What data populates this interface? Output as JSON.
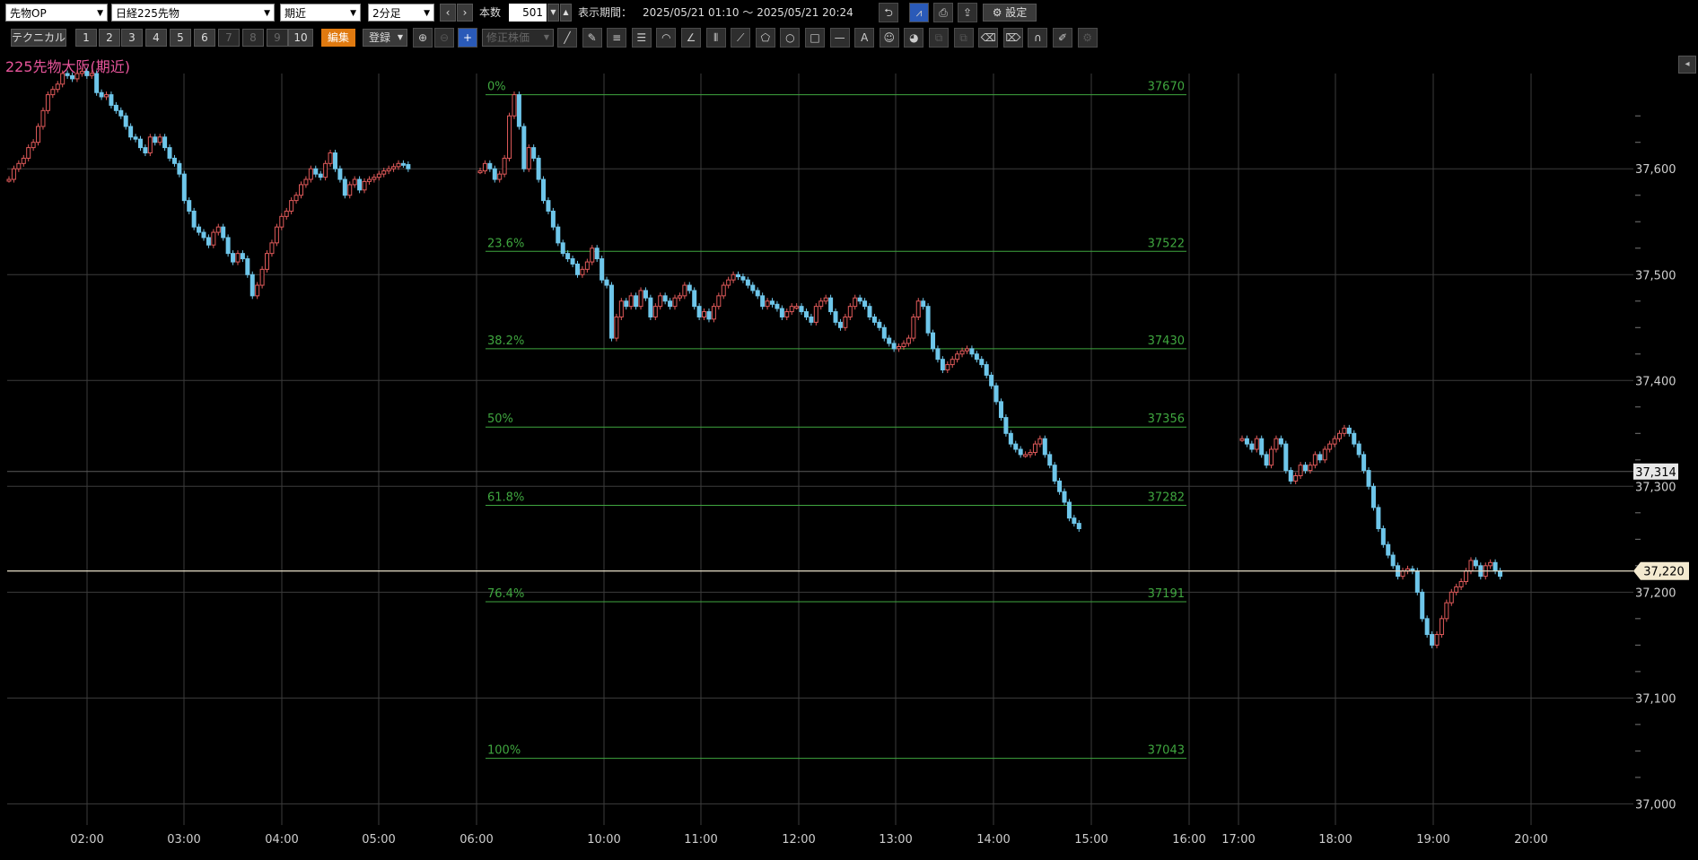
{
  "toolbar": {
    "product_select": "先物OP",
    "symbol_select": "日経225先物",
    "contract_select": "期近",
    "interval_select": "2分足",
    "bars_label": "本数",
    "bars_value": "501",
    "period_label": "表示期間：",
    "period_value": "2025/05/21 01:10 ～ 2025/05/21 20:24",
    "settings_label": "設定",
    "technical_label": "テクニカル",
    "preset_buttons": [
      "1",
      "2",
      "3",
      "4",
      "5",
      "6",
      "7",
      "8",
      "9",
      "10"
    ],
    "edit_label": "編集",
    "register_label": "登録",
    "adjusted_label": "修正株価"
  },
  "chart_title": "225先物大阪(期近)",
  "colors": {
    "up": "#e05a5a",
    "down": "#6ec6ea",
    "fib": "#3fa63f",
    "grid": "#3c3c3c",
    "title": "#e8559b"
  },
  "chart_data": {
    "type": "candlestick",
    "x_ticks": [
      "02:00",
      "03:00",
      "04:00",
      "05:00",
      "06:00",
      "10:00",
      "11:00",
      "12:00",
      "13:00",
      "14:00",
      "15:00",
      "16:00",
      "17:00",
      "18:00",
      "19:00",
      "20:00"
    ],
    "y_ticks": [
      "37,600",
      "37,500",
      "37,400",
      "37,300",
      "37,200",
      "37,100",
      "37,000"
    ],
    "ylim": [
      36980,
      37690
    ],
    "current_price_label": "37,220",
    "current_price": 37220,
    "marker_price_label": "37,314",
    "marker_price": 37314,
    "fibonacci": [
      {
        "label": "0%",
        "price": 37670
      },
      {
        "label": "23.6%",
        "price": 37522
      },
      {
        "label": "38.2%",
        "price": 37430
      },
      {
        "label": "50%",
        "price": 37356
      },
      {
        "label": "61.8%",
        "price": 37282
      },
      {
        "label": "76.4%",
        "price": 37191
      },
      {
        "label": "100%",
        "price": 37043
      }
    ],
    "fib_value_labels": [
      "37670",
      "37522",
      "37430",
      "37356",
      "37282",
      "37191",
      "37043"
    ],
    "segments": [
      {
        "time": "01:10",
        "closes": [
          37590,
          37600,
          37605,
          37610,
          37620,
          37625,
          37640,
          37655,
          37670,
          37675,
          37680,
          37690,
          37688,
          37685,
          37690,
          37692,
          37688,
          37690,
          37672,
          37668,
          37670,
          37660,
          37655,
          37650,
          37640,
          37630,
          37628,
          37620,
          37615,
          37630,
          37625,
          37630,
          37620,
          37610,
          37605,
          37595,
          37570,
          37560,
          37545,
          37540,
          37535,
          37528,
          37540,
          37545,
          37535,
          37520,
          37512,
          37520,
          37515,
          37500,
          37480,
          37490,
          37505,
          37520,
          37530,
          37545,
          37555,
          37560,
          37570,
          37575,
          37585,
          37590,
          37600,
          37595,
          37592,
          37605,
          37615,
          37600,
          37590,
          37575,
          37585,
          37590,
          37580,
          37588,
          37590,
          37592,
          37595,
          37598,
          37600,
          37602,
          37605,
          37604,
          37600
        ]
      },
      {
        "time": "06:00",
        "closes": [
          37598,
          37605,
          37600,
          37590,
          37595,
          37610,
          37650,
          37670,
          37640,
          37600,
          37620,
          37610,
          37590,
          37570,
          37560,
          37545,
          37530,
          37520,
          37515,
          37510,
          37500,
          37505,
          37512,
          37525,
          37515,
          37495,
          37490,
          37440,
          37460,
          37475,
          37470,
          37480,
          37470,
          37485,
          37478,
          37460,
          37470,
          37480,
          37475,
          37470,
          37478,
          37480,
          37490,
          37485,
          37470,
          37460,
          37465,
          37458,
          37470,
          37480,
          37490,
          37495,
          37500,
          37498,
          37495,
          37490,
          37485,
          37480,
          37470,
          37475,
          37472,
          37468,
          37460,
          37465,
          37470,
          37470,
          37465,
          37460,
          37455,
          37470,
          37475,
          37478,
          37465,
          37455,
          37450,
          37460,
          37470,
          37478,
          37475,
          37470,
          37460,
          37455,
          37450,
          37440,
          37435,
          37430,
          37432,
          37435,
          37440,
          37460,
          37475,
          37470,
          37445,
          37430,
          37420,
          37410,
          37415,
          37420,
          37425,
          37428,
          37430,
          37425,
          37420,
          37415,
          37405,
          37395,
          37380,
          37365,
          37350,
          37340,
          37335,
          37330,
          37330,
          37332,
          37340,
          37345,
          37330,
          37320,
          37305,
          37295,
          37285,
          37270,
          37265,
          37260
        ]
      },
      {
        "time": "17:00",
        "closes": [
          37345,
          37340,
          37335,
          37345,
          37330,
          37320,
          37335,
          37345,
          37340,
          37315,
          37305,
          37310,
          37320,
          37315,
          37320,
          37330,
          37325,
          37335,
          37340,
          37345,
          37350,
          37355,
          37350,
          37340,
          37330,
          37315,
          37300,
          37280,
          37260,
          37245,
          37235,
          37225,
          37215,
          37220,
          37222,
          37220,
          37200,
          37175,
          37160,
          37150,
          37160,
          37175,
          37190,
          37200,
          37205,
          37210,
          37220,
          37230,
          37225,
          37215,
          37225,
          37228,
          37220,
          37215
        ]
      }
    ]
  }
}
